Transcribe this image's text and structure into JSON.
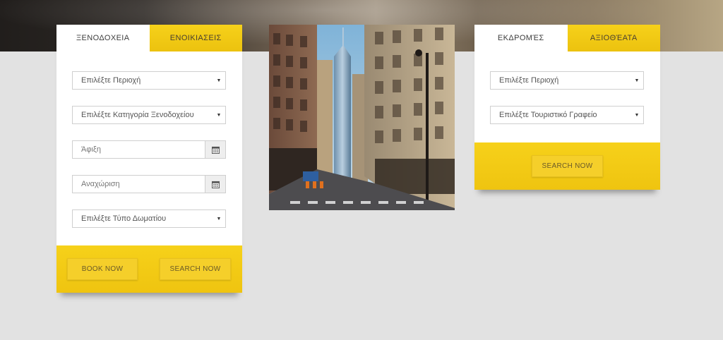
{
  "hotel_panel": {
    "tabs": [
      {
        "label": "ΞΕΝΟΔΟΧΕΙΑ",
        "active": true
      },
      {
        "label": "ΕΝΟΙΚΙΑΣΕΙΣ",
        "active": false
      }
    ],
    "region_select": "Επιλέξτε Περιοχή",
    "category_select": "Επιλέξτε Κατηγορία Ξενοδοχείου",
    "arrival_placeholder": "Άφιξη",
    "departure_placeholder": "Αναχώριση",
    "room_type_select": "Επιλέξτε Τύπο Δωματίου",
    "book_button": "BOOK NOW",
    "search_button": "SEARCH NOW"
  },
  "excursion_panel": {
    "tabs": [
      {
        "label": "ΕΚΔΡΟΜΈΣ",
        "active": true
      },
      {
        "label": "ΑΞΙΟΘΈΑΤΑ",
        "active": false
      }
    ],
    "region_select": "Επιλέξτε Περιοχή",
    "agency_select": "Επιλέξτε Τουριστικό Γραφείο",
    "search_button": "SEARCH NOW"
  },
  "icons": {
    "select_caret": "caret-down-icon",
    "date_picker": "calendar-icon"
  },
  "colors": {
    "accent_yellow": "#f2c811",
    "button_yellow": "#f5cf2a",
    "page_background": "#e2e2e2"
  }
}
